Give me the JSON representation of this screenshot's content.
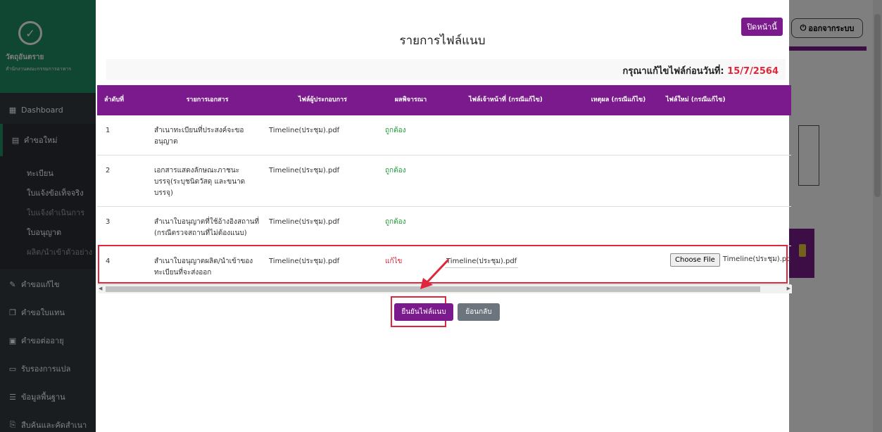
{
  "sidebar": {
    "logo_glyph": "✓",
    "org_name": "วัตถุอันตราย",
    "org_sub": "สำนักงานคณะกรรมการอาหาร",
    "dashboard": "Dashboard",
    "new_request": "คำขอใหม่",
    "sub_items": [
      "ทะเบียน",
      "ใบแจ้งข้อเท็จจริง",
      "ใบแจ้งดำเนินการ",
      "ใบอนุญาต",
      "ผลิต/นำเข้าตัวอย่าง"
    ],
    "items": [
      "คำขอแก้ไข",
      "คำขอใบแทน",
      "คำขอต่ออายุ",
      "รับรองการแปล",
      "ข้อมูลพื้นฐาน",
      "สืบค้นและคัดสำเนา"
    ]
  },
  "header": {
    "logout_label": "ออกจากระบบ"
  },
  "modal": {
    "close_label": "ปิดหน้านี้",
    "title": "รายการไฟล์แนบ",
    "deadline_label": "กรุณาแก้ไขไฟล์ก่อนวันที่:",
    "deadline_date": "15/7/2564",
    "columns": [
      "ลำดับที่",
      "รายการเอกสาร",
      "ไฟล์ผู้ประกอบการ",
      "ผลพิจารณา",
      "ไฟล์เจ้าหน้าที่ (กรณีแก้ไข)",
      "เหตุผล (กรณีแก้ไข)",
      "ไฟล์ใหม่ (กรณีแก้ไข)"
    ],
    "rows": [
      {
        "no": "1",
        "doc": "สำเนาทะเบียนที่ประสงค์จะขออนุญาต",
        "file": "Timeline(ประชุม).pdf",
        "result": "ถูกต้อง"
      },
      {
        "no": "2",
        "doc": "เอกสารแสดงลักษณะภาชนะบรรจุ(ระบุชนิดวัสดุ และขนาดบรรจุ)",
        "file": "Timeline(ประชุม).pdf",
        "result": "ถูกต้อง"
      },
      {
        "no": "3",
        "doc": "สำเนาใบอนุญาตที่ใช้อ้างอิงสถานที่ (กรณีตรวจสถานที่ไม่ต้องแนบ)",
        "file": "Timeline(ประชุม).pdf",
        "result": "ถูกต้อง"
      },
      {
        "no": "4",
        "doc": "สำเนาใบอนุญาตผลิต/นำเข้าของทะเบียนที่จะส่งออก",
        "file": "Timeline(ประชุม).pdf",
        "result": "แก้ไข",
        "officer_file": "Timeline(ประชุม).pdf",
        "choose_label": "Choose File",
        "new_file": "Timeline(ประชุม).pdf"
      }
    ],
    "confirm_label": "ยืนยันไฟล์แนบ",
    "back_label": "ย้อนกลับ"
  },
  "icons": {
    "dashboard": "dashboard-icon",
    "file": "file-icon",
    "edit": "edit-icon",
    "copy": "copy-icon",
    "renew": "calendar-icon",
    "translate": "translate-icon",
    "list": "list-icon",
    "search": "search-copy-icon",
    "power": "power-icon"
  },
  "colors": {
    "primary": "#7b1a8c",
    "ok": "#1f9a3a",
    "fix": "#e0263a",
    "sidebar": "#343a40",
    "brand": "#1e8e64"
  }
}
